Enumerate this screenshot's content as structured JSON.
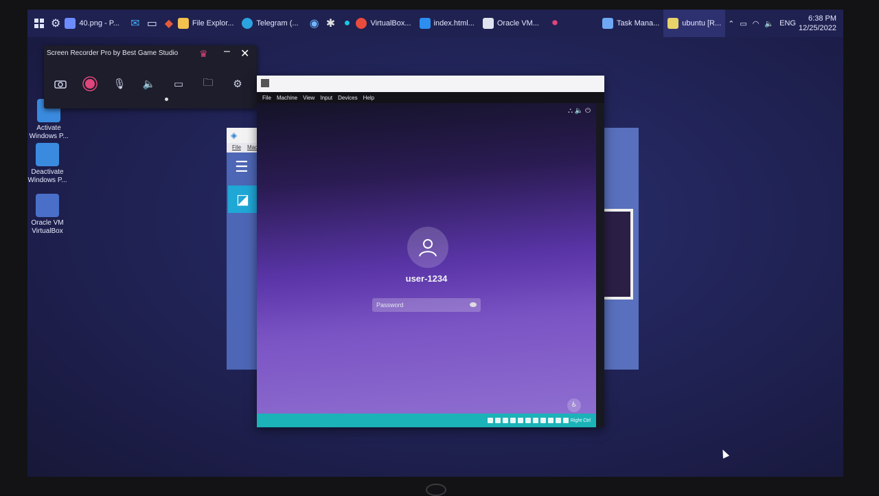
{
  "taskbar": {
    "items": [
      {
        "label": "40.png - P...",
        "icon": "image-icon",
        "color": "#6c8cff"
      },
      {
        "label": "File Explor...",
        "icon": "folder-icon",
        "color": "#f2c14e"
      },
      {
        "label": "Telegram (...",
        "icon": "telegram-icon",
        "color": "#2aa3e0"
      },
      {
        "label": "VirtualBox...",
        "icon": "chrome-icon",
        "color": "#e94b3c"
      },
      {
        "label": "index.html...",
        "icon": "vscode-icon",
        "color": "#2c8ef0"
      },
      {
        "label": "Oracle VM...",
        "icon": "virtualbox-icon",
        "color": "#dfe3ef"
      },
      {
        "label": "Task Mana...",
        "icon": "task-manager-icon",
        "color": "#6fa7f5"
      },
      {
        "label": "ubuntu [R...",
        "icon": "virtualbox-vm-icon",
        "color": "#e8d36b"
      }
    ],
    "tray": {
      "language": "ENG",
      "time": "6:38 PM",
      "date": "12/25/2022"
    }
  },
  "desktop": {
    "icons": [
      {
        "label": "Activate Windows P...",
        "color": "#3a8be0"
      },
      {
        "label": "Deactivate Windows P...",
        "color": "#3a8be0"
      },
      {
        "label": "Oracle VM VirtualBox",
        "color": "#4a6fc8"
      }
    ]
  },
  "recorder": {
    "title": "Screen Recorder Pro by Best Game Studio",
    "accent": "#e0457b"
  },
  "vm": {
    "menu": [
      "File",
      "Machine",
      "View",
      "Input",
      "Devices",
      "Help"
    ],
    "login": {
      "username": "user-1234",
      "password_placeholder": "Password"
    },
    "status_right": "Right Ctrl"
  },
  "back_window": {
    "menu": [
      "File",
      "Mach"
    ]
  }
}
